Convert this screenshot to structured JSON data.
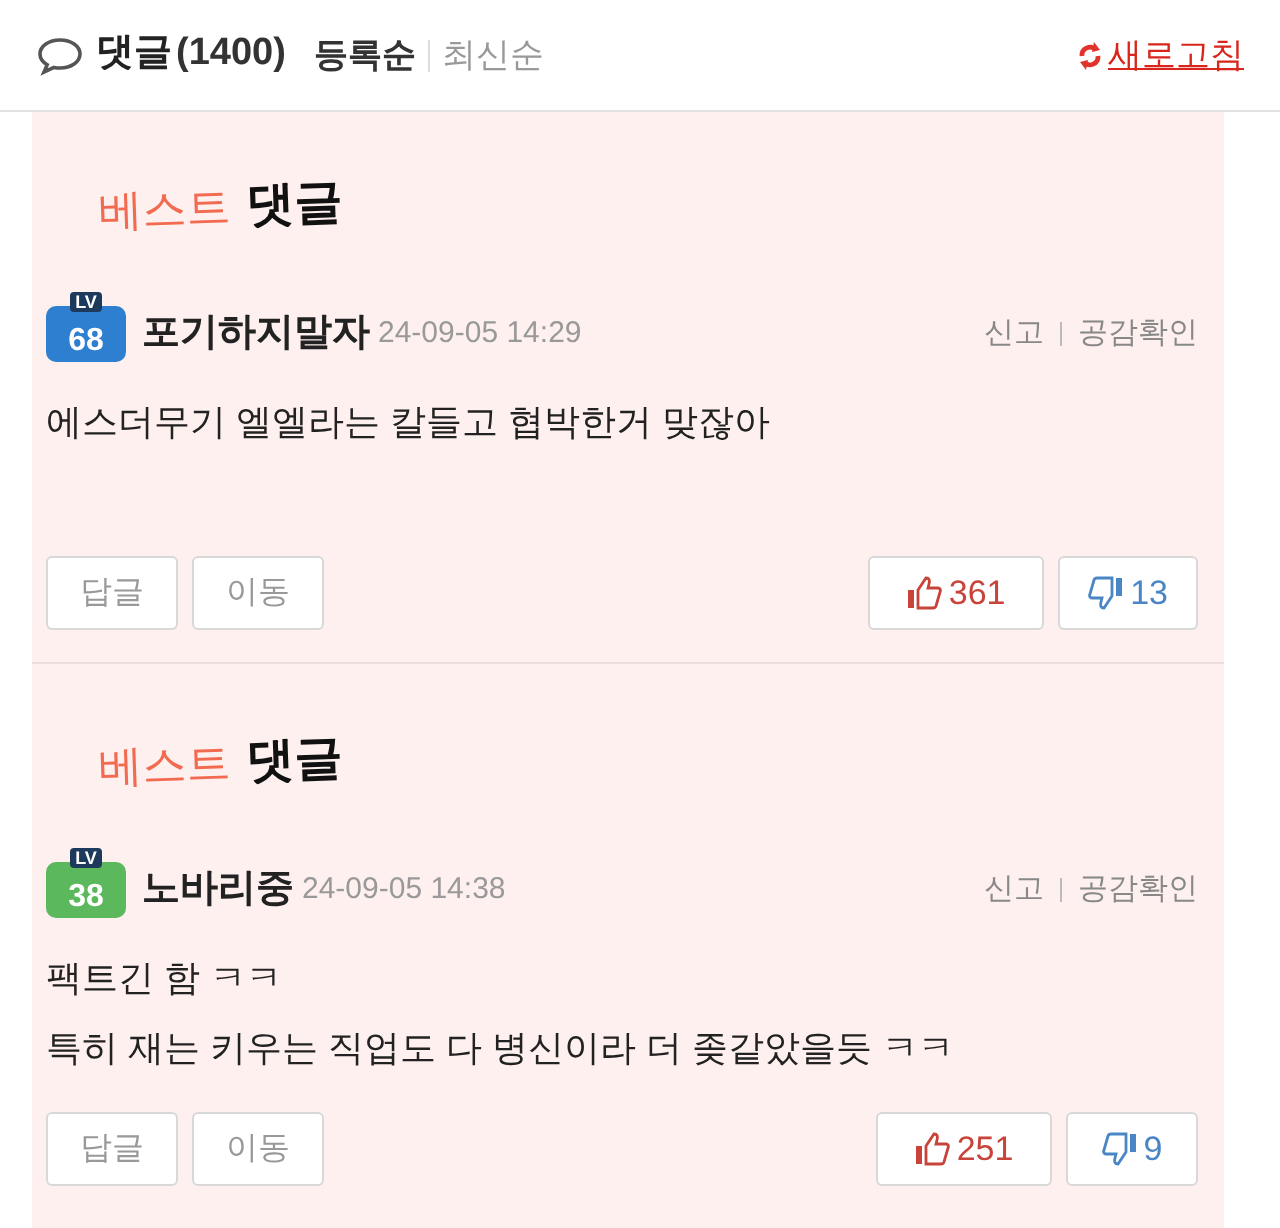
{
  "header": {
    "title": "댓글",
    "count": "(1400)",
    "sort_options": [
      {
        "label": "등록순",
        "selected": true
      },
      {
        "label": "최신순",
        "selected": false
      }
    ],
    "refresh": "새로고침"
  },
  "comments": [
    {
      "banner": {
        "word1": "베스트",
        "word2": "댓글"
      },
      "level_badge": {
        "prefix": "LV",
        "number": "68",
        "color": "#2f7fd0"
      },
      "author": "포기하지말자",
      "time": "24-09-05 14:29",
      "report": "신고",
      "empathy": "공감확인",
      "lines": [
        "에스더무기 엘엘라는 칼들고 협박한거 맞잖아"
      ],
      "reply": "답글",
      "move": "이동",
      "likes": "361",
      "dislikes": "13"
    },
    {
      "banner": {
        "word1": "베스트",
        "word2": "댓글"
      },
      "level_badge": {
        "prefix": "LV",
        "number": "38",
        "color": "#5cb85c"
      },
      "author": "노바리중",
      "time": "24-09-05 14:38",
      "report": "신고",
      "empathy": "공감확인",
      "lines": [
        "팩트긴 함 ㅋㅋ",
        "특히 재는 키우는 직업도 다 병신이라 더 좆같았을듯 ㅋㅋ"
      ],
      "reply": "답글",
      "move": "이동",
      "likes": "251",
      "dislikes": "9"
    }
  ]
}
